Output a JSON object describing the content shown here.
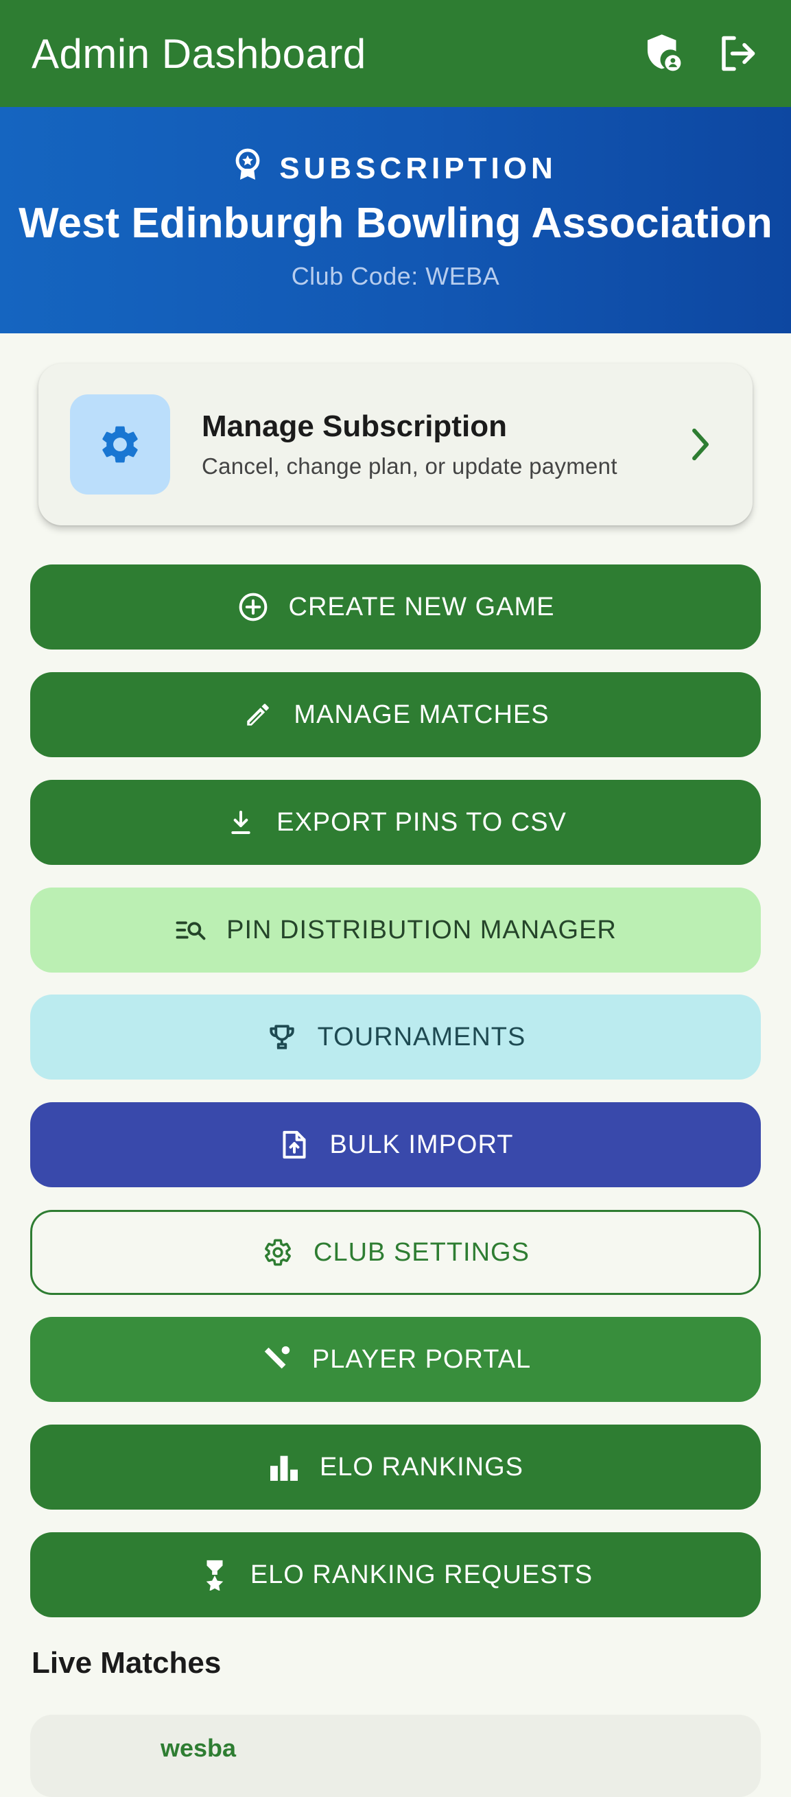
{
  "app_bar": {
    "title": "Admin Dashboard",
    "actions": [
      {
        "icon": "admin-shield-icon"
      },
      {
        "icon": "logout-icon"
      }
    ]
  },
  "banner": {
    "kicker": "SUBSCRIPTION",
    "organization": "West Edinburgh Bowling Association",
    "club_code": "Club Code: WEBA"
  },
  "manage_card": {
    "title": "Manage Subscription",
    "subtitle": "Cancel, change plan, or update payment"
  },
  "buttons": [
    {
      "label": "CREATE NEW GAME",
      "icon": "add-circle-icon"
    },
    {
      "label": "MANAGE MATCHES",
      "icon": "pencil-icon"
    },
    {
      "label": "EXPORT PINS TO CSV",
      "icon": "download-icon"
    },
    {
      "label": "PIN DISTRIBUTION MANAGER",
      "icon": "list-search-icon"
    },
    {
      "label": "TOURNAMENTS",
      "icon": "trophy-icon"
    },
    {
      "label": "BULK IMPORT",
      "icon": "file-upload-icon"
    },
    {
      "label": "CLUB SETTINGS",
      "icon": "gear-icon"
    },
    {
      "label": "PLAYER PORTAL",
      "icon": "sports-icon"
    },
    {
      "label": "ELO RANKINGS",
      "icon": "leaderboard-icon"
    },
    {
      "label": "ELO RANKING REQUESTS",
      "icon": "award-icon"
    }
  ],
  "live_matches": {
    "title": "Live Matches",
    "items": [
      {
        "name": "wesba"
      }
    ]
  },
  "colors": {
    "primary": "#2e7d32",
    "banner": "#1565c0",
    "mint": "#bbefb3",
    "cyan": "#bbebef",
    "indigo": "#3949ab",
    "background": "#f6f8f1"
  }
}
